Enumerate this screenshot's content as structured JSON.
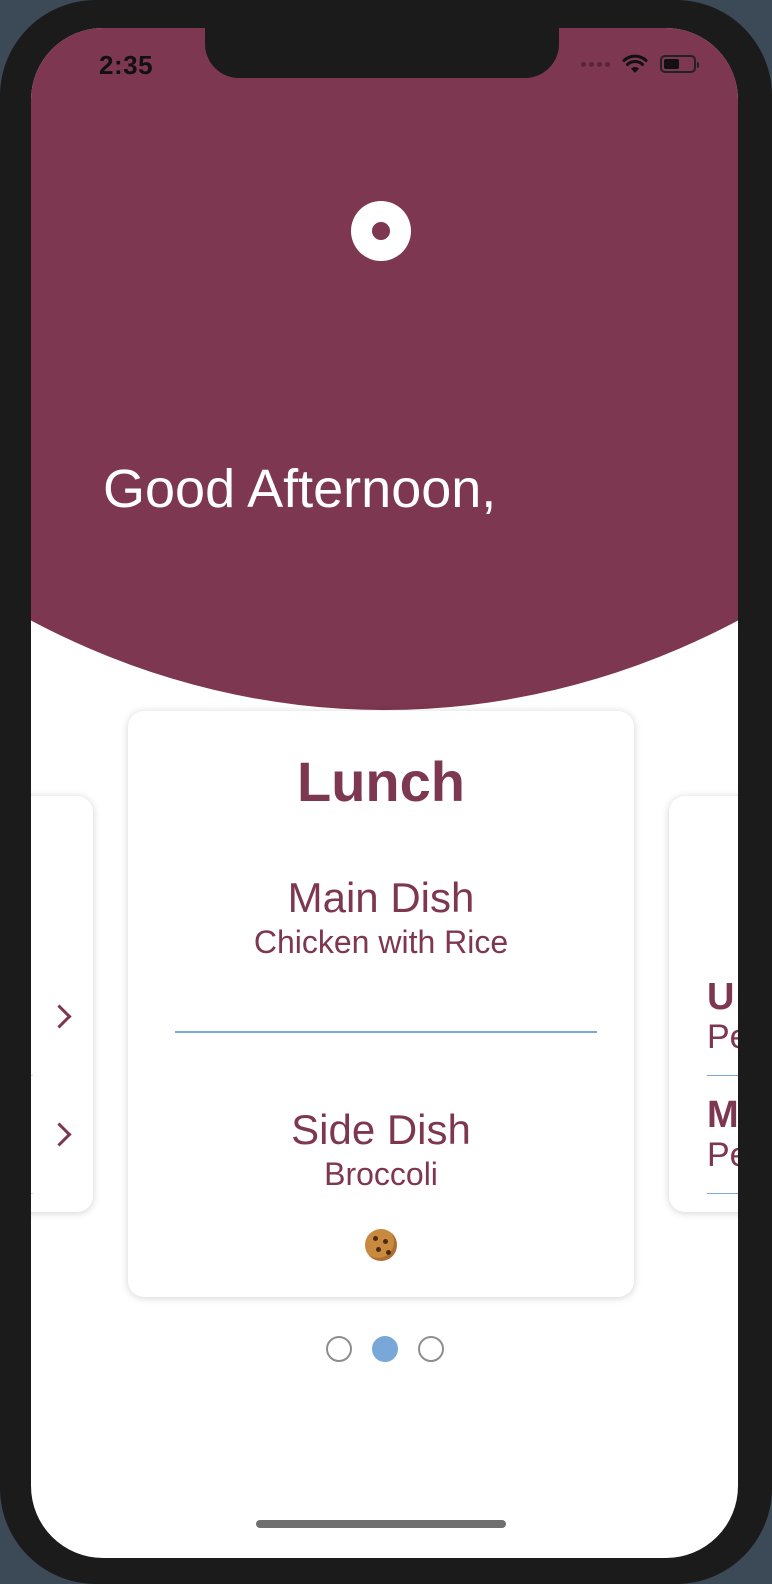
{
  "status_bar": {
    "time": "2:35"
  },
  "header": {
    "greeting": "Good Afternoon,",
    "background_color": "#7d3750"
  },
  "main_card": {
    "meal": "Lunch",
    "main_dish_label": "Main Dish",
    "main_dish": "Chicken with Rice",
    "side_dish_label": "Side Dish",
    "side_dish": "Broccoli",
    "dessert_icon": "cookie-icon"
  },
  "left_card": {
    "icons": [
      "chevron-right-icon",
      "chevron-right-icon"
    ]
  },
  "right_card": {
    "item1_title": "U",
    "item1_value": "Pe",
    "item2_title": "M",
    "item2_value": "Pe"
  },
  "pager": {
    "count": 3,
    "active_index": 1,
    "active_color": "#79a8d8"
  }
}
